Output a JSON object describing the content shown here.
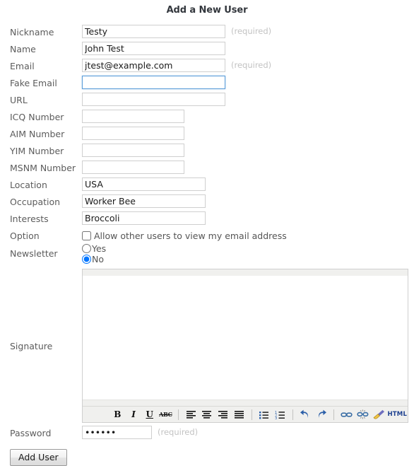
{
  "page": {
    "title": "Add a New User"
  },
  "form": {
    "fields": [
      {
        "label": "Nickname",
        "value": "Testy",
        "required_text": "(required)",
        "focused": false
      },
      {
        "label": "Name",
        "value": "John Test",
        "required_text": "",
        "focused": false
      },
      {
        "label": "Email",
        "value": "jtest@example.com",
        "required_text": "(required)",
        "focused": false
      },
      {
        "label": "Fake Email",
        "value": "",
        "required_text": "",
        "focused": true
      },
      {
        "label": "URL",
        "value": "",
        "required_text": "",
        "focused": false
      },
      {
        "label": "ICQ Number",
        "value": "",
        "required_text": "",
        "focused": false
      },
      {
        "label": "AIM Number",
        "value": "",
        "required_text": "",
        "focused": false
      },
      {
        "label": "YIM Number",
        "value": "",
        "required_text": "",
        "focused": false
      },
      {
        "label": "MSNM Number",
        "value": "",
        "required_text": "",
        "focused": false
      },
      {
        "label": "Location",
        "value": "USA",
        "required_text": "",
        "focused": false
      },
      {
        "label": "Occupation",
        "value": "Worker Bee",
        "required_text": "",
        "focused": false
      },
      {
        "label": "Interests",
        "value": "Broccoli",
        "required_text": "",
        "focused": false
      }
    ],
    "option": {
      "label": "Option",
      "checkbox_label": "Allow other users to view my email address",
      "checked": false
    },
    "newsletter": {
      "label": "Newsletter",
      "options": [
        {
          "label": "Yes",
          "selected": false
        },
        {
          "label": "No",
          "selected": true
        }
      ]
    },
    "signature": {
      "label": "Signature",
      "value": ""
    },
    "password": {
      "label": "Password",
      "value": "••••••",
      "required_text": "(required)"
    },
    "submit_label": "Add User"
  },
  "editor": {
    "toolbar": [
      {
        "name": "bold",
        "glyph": "B"
      },
      {
        "name": "italic",
        "glyph": "I"
      },
      {
        "name": "underline",
        "glyph": "U"
      },
      {
        "name": "strikethrough",
        "glyph": "ABC"
      },
      {
        "name": "align-left",
        "glyph": ""
      },
      {
        "name": "align-center",
        "glyph": ""
      },
      {
        "name": "align-right",
        "glyph": ""
      },
      {
        "name": "align-justify",
        "glyph": ""
      },
      {
        "name": "bullet-list",
        "glyph": ""
      },
      {
        "name": "numbered-list",
        "glyph": ""
      },
      {
        "name": "undo",
        "glyph": ""
      },
      {
        "name": "redo",
        "glyph": ""
      },
      {
        "name": "link",
        "glyph": ""
      },
      {
        "name": "unlink",
        "glyph": ""
      },
      {
        "name": "cleanup",
        "glyph": ""
      },
      {
        "name": "html-source",
        "glyph": "HTML"
      }
    ]
  },
  "colors": {
    "accent_blue": "#2b5fa8",
    "focus_border": "#5b9dd9",
    "label_gray": "#5c5c5c",
    "required_gray": "#c3c3c3",
    "toolbar_bg": "#f0f0ee"
  }
}
